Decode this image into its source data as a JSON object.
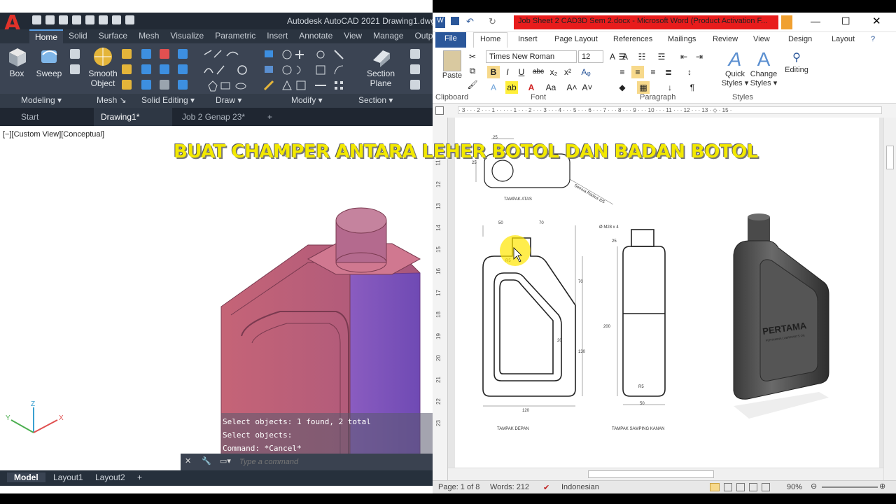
{
  "overlay_caption": "BUAT CHAMPER ANTARA LEHER BOTOL DAN BADAN BOTOL",
  "autocad": {
    "logo": "A",
    "title": "Autodesk AutoCAD 2021    Drawing1.dwg",
    "tabs": [
      "Home",
      "Solid",
      "Surface",
      "Mesh",
      "Visualize",
      "Parametric",
      "Insert",
      "Annotate",
      "View",
      "Manage",
      "Outp"
    ],
    "ribbon": {
      "box": "Box",
      "sweep": "Sweep",
      "smooth_object": "Smooth Object",
      "section_plane": "Section Plane"
    },
    "panels": [
      "Modeling ▾",
      "Mesh ↘",
      "Solid Editing ▾",
      "Draw ▾",
      "Modify ▾",
      "Section ▾"
    ],
    "doc_tabs": [
      "Start",
      "Drawing1*",
      "Job 2 Genap 23*",
      "+"
    ],
    "view_label": "[−][Custom View][Conceptual]",
    "command_history": [
      "Select objects: 1 found, 2 total",
      "Select objects:",
      "Command: *Cancel*"
    ],
    "command_placeholder": "Type a command",
    "layout_tabs": [
      "Model",
      "Layout1",
      "Layout2",
      "+"
    ],
    "axes": {
      "z": "Z",
      "y": "Y",
      "x": "X"
    },
    "accent": "#e0322a"
  },
  "word": {
    "title": "Job Sheet 2 CAD3D Sem 2.docx - Microsoft Word (Product Activation F...",
    "tabs": [
      "File",
      "Home",
      "Insert",
      "Page Layout",
      "References",
      "Mailings",
      "Review",
      "View",
      "Design",
      "Layout"
    ],
    "clipboard": {
      "paste": "Paste",
      "group": "Clipboard"
    },
    "font": {
      "name": "Times New Roman",
      "size": "12",
      "group": "Font"
    },
    "paragraph_group": "Paragraph",
    "styles": {
      "quick": "Quick Styles ▾",
      "change": "Change Styles ▾",
      "group": "Styles"
    },
    "editing": "Editing",
    "ruler_numbers": "· 3 · · · 2 · · · 1 · · · · · 1 · · · 2 · · · 3 · · · 4 · · · 5 · · · 6 · · · 7 · · · 8 · · · 9 · · · 10 · · · 11 · · · 12 · · · 13 · ◇ · 15 ·",
    "vruler_numbers": [
      "11",
      "12",
      "13",
      "14",
      "15",
      "16",
      "17",
      "18",
      "19",
      "20",
      "21",
      "22",
      "23"
    ],
    "drawing": {
      "top_label": "TAMPAK ATAS",
      "front_label": "TAMPAK DEPAN",
      "side_label": "TAMPAK SAMPING KANAN",
      "dims": {
        "d25a": "25",
        "d25b": "25",
        "d50": "50",
        "d70": "70",
        "d70v": "70",
        "d20": "20",
        "d130": "130",
        "d120": "120",
        "d200": "200",
        "d50b": "50",
        "m28": "Ø M28 x 4",
        "d25c": "25",
        "r5": "R5",
        "r5b": "R5",
        "radius_note": "Semua Radius 8/5"
      },
      "bottle_brand": "PERTAMA",
      "bottle_sub": "PERTAMINA LUBRICANTS OIL"
    },
    "status": {
      "page": "Page: 1 of 8",
      "words": "Words: 212",
      "lang": "Indonesian",
      "zoom": "90%"
    }
  }
}
